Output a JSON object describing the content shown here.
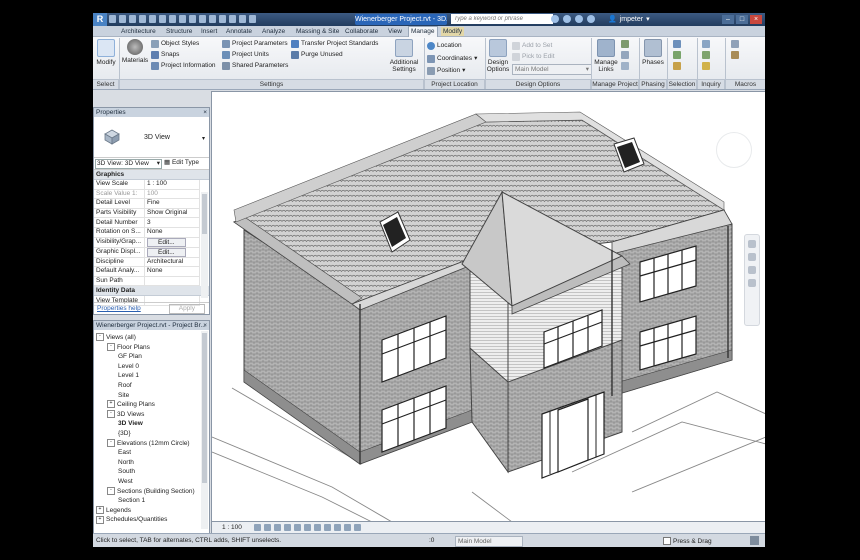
{
  "window": {
    "app_logo": "R",
    "document_title": "Wienerberger Project.rvt - 3D...",
    "search_placeholder": "Type a keyword or phrase",
    "user": "jmpeter",
    "window_buttons": [
      "–",
      "□",
      "×"
    ]
  },
  "ribbon": {
    "tabs": [
      "Architecture",
      "Structure",
      "Insert",
      "Annotate",
      "Analyze",
      "Massing & Site",
      "Collaborate",
      "View",
      "Manage",
      "Modify"
    ],
    "active_tab": "Manage",
    "select": {
      "modify": "Modify",
      "label": "Select"
    },
    "settings": {
      "materials": "Materials",
      "object_styles": "Object Styles",
      "snaps": "Snaps",
      "project_information": "Project Information",
      "project_parameters": "Project Parameters",
      "project_units": "Project Units",
      "shared_parameters": "Shared Parameters",
      "transfer_standards": "Transfer Project Standards",
      "purge_unused": "Purge Unused",
      "additional_settings": "Additional Settings",
      "label": "Settings"
    },
    "project_location": {
      "location": "Location",
      "coordinates": "Coordinates",
      "position": "Position",
      "label": "Project Location"
    },
    "design_options": {
      "design_options": "Design Options",
      "add_to_set": "Add to Set",
      "pick_to_edit": "Pick to Edit",
      "main_model": "Main Model",
      "label": "Design Options"
    },
    "manage_project": {
      "manage_links": "Manage Links",
      "label": "Manage Project"
    },
    "phasing": {
      "phases": "Phases",
      "label": "Phasing"
    },
    "selection": {
      "label": "Selection"
    },
    "inquiry": {
      "label": "Inquiry"
    },
    "macros": {
      "label": "Macros"
    }
  },
  "properties": {
    "title": "Properties",
    "type_name": "3D View",
    "instance_selector": "3D View: 3D View",
    "edit_type": "Edit Type",
    "group_graphics": "Graphics",
    "rows": [
      {
        "k": "View Scale",
        "v": "1 : 100"
      },
      {
        "k": "Scale Value    1:",
        "v": "100",
        "dim": true
      },
      {
        "k": "Detail Level",
        "v": "Fine"
      },
      {
        "k": "Parts Visibility",
        "v": "Show Original"
      },
      {
        "k": "Detail Number",
        "v": "3"
      },
      {
        "k": "Rotation on S...",
        "v": "None"
      },
      {
        "k": "Visibility/Grap...",
        "v": "Edit...",
        "button": true
      },
      {
        "k": "Graphic Displ...",
        "v": "Edit...",
        "button": true
      },
      {
        "k": "Discipline",
        "v": "Architectural"
      },
      {
        "k": "Default Analy...",
        "v": "None"
      },
      {
        "k": "Sun Path",
        "v": ""
      }
    ],
    "group_identity": "Identity Data",
    "view_template_row": "View Template",
    "help": "Properties help",
    "apply": "Apply"
  },
  "browser": {
    "title": "Wienerberger Project.rvt - Project Br...",
    "tree": [
      {
        "label": "Views (all)",
        "level": 0,
        "toggle": "-"
      },
      {
        "label": "Floor Plans",
        "level": 1,
        "toggle": "-"
      },
      {
        "label": "GF Plan",
        "level": 2
      },
      {
        "label": "Level 0",
        "level": 2
      },
      {
        "label": "Level 1",
        "level": 2
      },
      {
        "label": "Roof",
        "level": 2
      },
      {
        "label": "Site",
        "level": 2
      },
      {
        "label": "Ceiling Plans",
        "level": 1,
        "toggle": "+"
      },
      {
        "label": "3D Views",
        "level": 1,
        "toggle": "-"
      },
      {
        "label": "3D View",
        "level": 2,
        "bold": true
      },
      {
        "label": "{3D}",
        "level": 2
      },
      {
        "label": "Elevations (12mm Circle)",
        "level": 1,
        "toggle": "-"
      },
      {
        "label": "East",
        "level": 2
      },
      {
        "label": "North",
        "level": 2
      },
      {
        "label": "South",
        "level": 2
      },
      {
        "label": "West",
        "level": 2
      },
      {
        "label": "Sections (Building Section)",
        "level": 1,
        "toggle": "-"
      },
      {
        "label": "Section 1",
        "level": 2
      },
      {
        "label": "Legends",
        "level": 0,
        "toggle": "+"
      },
      {
        "label": "Schedules/Quantities",
        "level": 0,
        "toggle": "+"
      }
    ]
  },
  "view_control": {
    "scale": "1 : 100"
  },
  "status": {
    "message": "Click to select, TAB for alternates, CTRL adds, SHIFT unselects.",
    "zero": ":0",
    "workset": "Main Model",
    "press_drag": "Press & Drag"
  },
  "colors": {
    "title_bar": "#2a4468",
    "active_doc": "#2a66b8",
    "brick": "#9a9a9a"
  }
}
